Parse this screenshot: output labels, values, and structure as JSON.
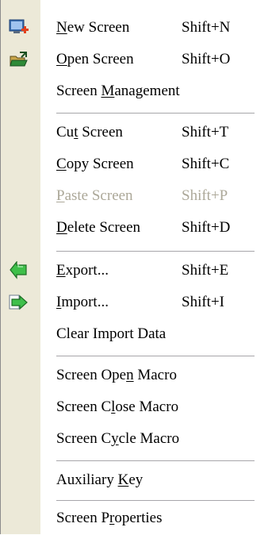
{
  "menu": {
    "items": [
      {
        "pre": "",
        "u": "N",
        "post": "ew Screen",
        "shortcut": "Shift+N",
        "enabled": true,
        "icon": "new-screen-icon"
      },
      {
        "pre": "",
        "u": "O",
        "post": "pen Screen",
        "shortcut": "Shift+O",
        "enabled": true,
        "icon": "open-screen-icon"
      },
      {
        "pre": "Screen ",
        "u": "M",
        "post": "anagement",
        "shortcut": "",
        "enabled": true
      },
      {
        "pre": "Cu",
        "u": "t",
        "post": " Screen",
        "shortcut": "Shift+T",
        "enabled": true
      },
      {
        "pre": "",
        "u": "C",
        "post": "opy Screen",
        "shortcut": "Shift+C",
        "enabled": true
      },
      {
        "pre": "",
        "u": "P",
        "post": "aste Screen",
        "shortcut": "Shift+P",
        "enabled": false
      },
      {
        "pre": "",
        "u": "D",
        "post": "elete Screen",
        "shortcut": "Shift+D",
        "enabled": true
      },
      {
        "pre": "",
        "u": "E",
        "post": "xport...",
        "shortcut": "Shift+E",
        "enabled": true,
        "icon": "export-icon"
      },
      {
        "pre": "",
        "u": "I",
        "post": "mport...",
        "shortcut": "Shift+I",
        "enabled": true,
        "icon": "import-icon"
      },
      {
        "pre": "Clear Import Data",
        "u": "",
        "post": "",
        "shortcut": "",
        "enabled": true
      },
      {
        "pre": "Screen Ope",
        "u": "n",
        "post": " Macro",
        "shortcut": "",
        "enabled": true
      },
      {
        "pre": "Screen C",
        "u": "l",
        "post": "ose Macro",
        "shortcut": "",
        "enabled": true
      },
      {
        "pre": "Screen C",
        "u": "y",
        "post": "cle Macro",
        "shortcut": "",
        "enabled": true
      },
      {
        "pre": "Auxiliary ",
        "u": "K",
        "post": "ey",
        "shortcut": "",
        "enabled": true
      },
      {
        "pre": "Screen P",
        "u": "r",
        "post": "operties",
        "shortcut": "",
        "enabled": true
      }
    ]
  },
  "colors": {
    "gutter": "#ece9d8",
    "disabled_text": "#aca899",
    "separator": "#a7a6aa"
  }
}
